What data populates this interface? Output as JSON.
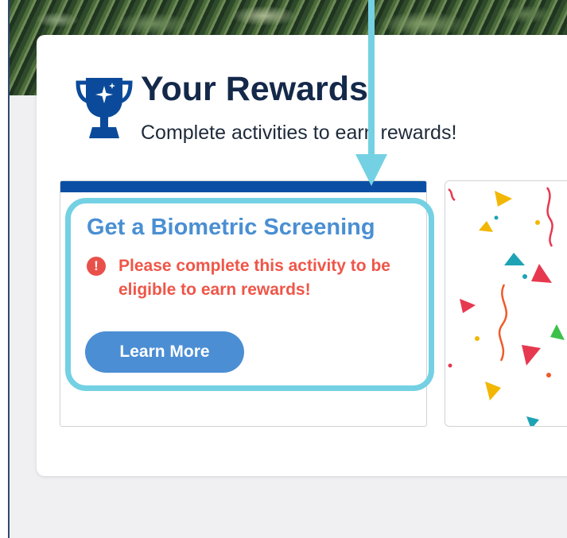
{
  "rewards": {
    "title": "Your Rewards",
    "subtitle": "Complete activities to earn rewards!",
    "trophy_icon": "trophy-icon"
  },
  "activity": {
    "title": "Get a Biometric Screening",
    "warning_icon": "alert-circle-icon",
    "warning_symbol": "!",
    "warning_text": "Please complete this activity to be eligible to earn rewards!",
    "button_label": "Learn More"
  },
  "colors": {
    "brand_navy": "#14294a",
    "card_topbar": "#0a4fa3",
    "link_blue": "#4a8fd3",
    "warning_red": "#ef5648",
    "button_blue": "#4b8ed4",
    "annotation_cyan": "#74d1e3"
  }
}
